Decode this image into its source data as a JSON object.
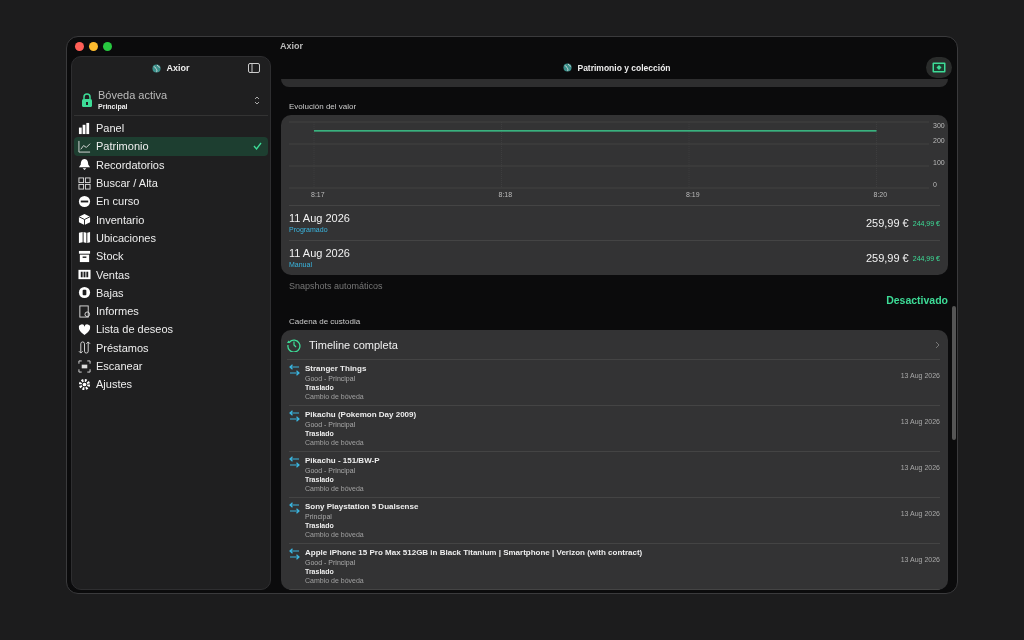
{
  "window": {
    "title": "Axior"
  },
  "sidebar": {
    "title": "Axior",
    "vault": {
      "label": "Bóveda activa",
      "value": "Principal"
    },
    "items": [
      {
        "label": "Panel",
        "selected": false
      },
      {
        "label": "Patrimonio",
        "selected": true
      },
      {
        "label": "Recordatorios",
        "selected": false
      },
      {
        "label": "Buscar / Alta",
        "selected": false
      },
      {
        "label": "En curso",
        "selected": false
      },
      {
        "label": "Inventario",
        "selected": false
      },
      {
        "label": "Ubicaciones",
        "selected": false
      },
      {
        "label": "Stock",
        "selected": false
      },
      {
        "label": "Ventas",
        "selected": false
      },
      {
        "label": "Bajas",
        "selected": false
      },
      {
        "label": "Informes",
        "selected": false
      },
      {
        "label": "Lista de deseos",
        "selected": false
      },
      {
        "label": "Préstamos",
        "selected": false
      },
      {
        "label": "Escanear",
        "selected": false
      },
      {
        "label": "Ajustes",
        "selected": false
      }
    ]
  },
  "main": {
    "title": "Patrimonio y colección",
    "value_section": {
      "title": "Evolución del valor",
      "chart_data": {
        "type": "line",
        "categories": [
          "8:17",
          "8:18",
          "8:19",
          "8:20"
        ],
        "series": [
          {
            "color": "#3ddc97",
            "values": [
              260,
              260,
              260,
              260
            ]
          }
        ],
        "ylim": [
          0,
          300
        ],
        "yticks": [
          0,
          100,
          200,
          300
        ],
        "grid": true
      },
      "entries": [
        {
          "date": "11 Aug 2026",
          "source": "Programado",
          "value": "259,99 €",
          "previous": "244,99 €"
        },
        {
          "date": "11 Aug 2026",
          "source": "Manual",
          "value": "259,99 €",
          "previous": "244,99 €"
        }
      ]
    },
    "snapshots": {
      "label": "Snapshots automáticos",
      "status": "Desactivado"
    },
    "custody": {
      "title": "Cadena de custodia",
      "header": "Timeline completa",
      "events": [
        {
          "title": "Stranger Things",
          "detail": "Good - Principal",
          "type": "Traslado",
          "note": "Cambio de bóveda",
          "date": "13 Aug 2026"
        },
        {
          "title": "Pikachu (Pokemon Day 2009)",
          "detail": "Good - Principal",
          "type": "Traslado",
          "note": "Cambio de bóveda",
          "date": "13 Aug 2026"
        },
        {
          "title": "Pikachu - 151/BW-P",
          "detail": "Good - Principal",
          "type": "Traslado",
          "note": "Cambio de bóveda",
          "date": "13 Aug 2026"
        },
        {
          "title": "Sony Playstation 5 Dualsense",
          "detail": "Principal",
          "type": "Traslado",
          "note": "Cambio de bóveda",
          "date": "13 Aug 2026"
        },
        {
          "title": "Apple iPhone 15 Pro Max 512GB in Black Titanium | Smartphone | Verizon (with contract)",
          "detail": "Good - Principal",
          "type": "Traslado",
          "note": "Cambio de bóveda",
          "date": "13 Aug 2026"
        }
      ]
    }
  }
}
